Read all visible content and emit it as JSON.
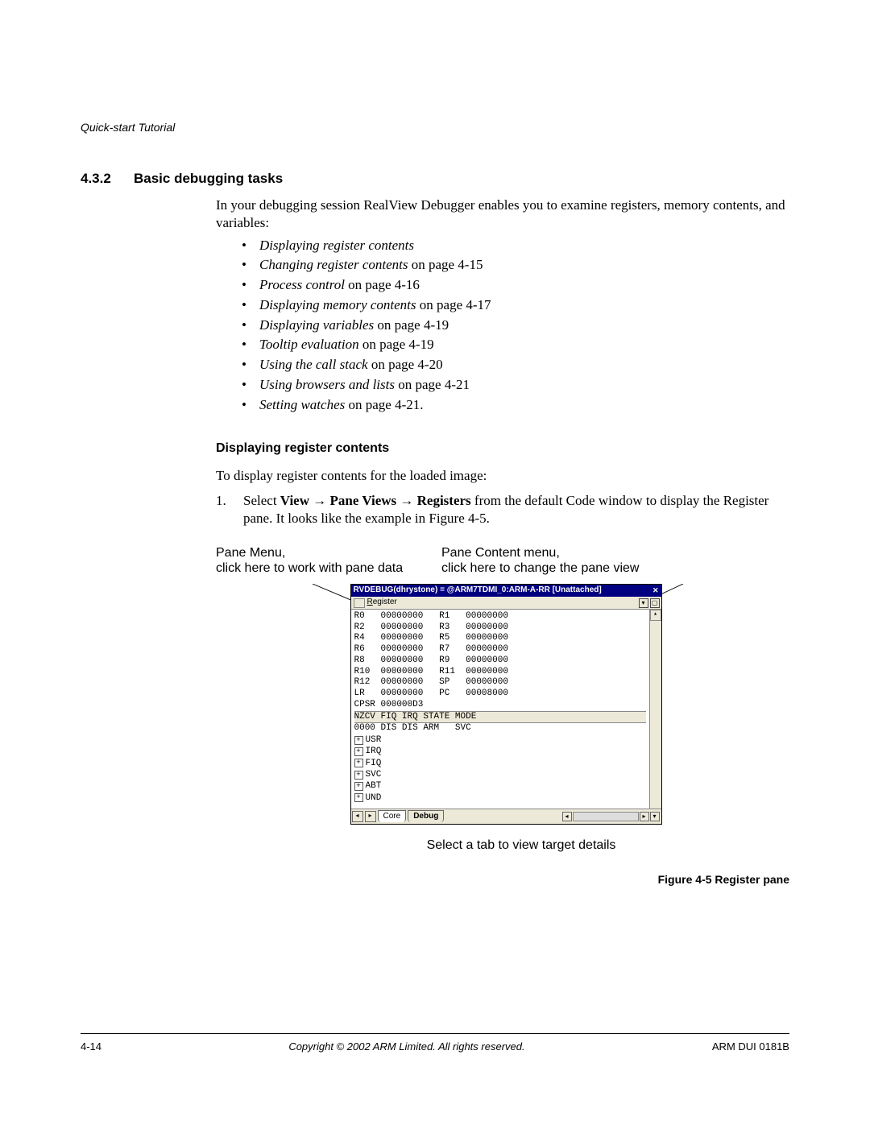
{
  "header": {
    "running_head": "Quick-start Tutorial"
  },
  "section": {
    "number": "4.3.2",
    "title": "Basic debugging tasks"
  },
  "intro": {
    "p1": "In your debugging session RealView Debugger enables you to examine registers, memory contents, and variables:"
  },
  "bullets": [
    {
      "ital": "Displaying register contents",
      "rest": ""
    },
    {
      "ital": "Changing register contents",
      "rest": " on page 4-15"
    },
    {
      "ital": "Process control",
      "rest": " on page 4-16"
    },
    {
      "ital": "Displaying memory contents",
      "rest": " on page 4-17"
    },
    {
      "ital": "Displaying variables",
      "rest": " on page 4-19"
    },
    {
      "ital": "Tooltip evaluation",
      "rest": " on page 4-19"
    },
    {
      "ital": "Using the call stack",
      "rest": " on page 4-20"
    },
    {
      "ital": "Using browsers and lists",
      "rest": " on page 4-21"
    },
    {
      "ital": "Setting watches",
      "rest": " on page 4-21."
    }
  ],
  "sub": {
    "heading": "Displaying register contents",
    "p1": "To display register contents for the loaded image:",
    "step1": {
      "num": "1.",
      "pre": "Select ",
      "m1": "View",
      "arrow1": " → ",
      "m2": "Pane Views",
      "arrow2": " → ",
      "m3": "Registers",
      "post": " from the default Code window to display the Register pane. It looks like the example in Figure 4-5."
    }
  },
  "labels": {
    "left_l1": "Pane Menu,",
    "left_l2": "click here to work with pane data",
    "right_l1": "Pane Content menu,",
    "right_l2": "click here to change the pane view",
    "below": "Select a tab to view target details"
  },
  "figure": {
    "caption": "Figure 4-5 Register pane"
  },
  "window": {
    "title": "RVDEBUG(dhrystone) = @ARM7TDMI_0:ARM-A-RR [Unattached]",
    "menu": {
      "register": "Register"
    },
    "registers": [
      [
        "R0",
        "00000000",
        "R1",
        "00000000"
      ],
      [
        "R2",
        "00000000",
        "R3",
        "00000000"
      ],
      [
        "R4",
        "00000000",
        "R5",
        "00000000"
      ],
      [
        "R6",
        "00000000",
        "R7",
        "00000000"
      ],
      [
        "R8",
        "00000000",
        "R9",
        "00000000"
      ],
      [
        "R10",
        "00000000",
        "R11",
        "00000000"
      ],
      [
        "R12",
        "00000000",
        "SP",
        "00000000"
      ],
      [
        "LR",
        "00000000",
        "PC",
        "00008000"
      ]
    ],
    "cpsr": {
      "label": "CPSR",
      "value": "000000D3"
    },
    "status_header": [
      "NZCV",
      "FIQ",
      "IRQ",
      "STATE",
      "MODE"
    ],
    "status_row": [
      "0000",
      "DIS",
      "DIS",
      "ARM",
      "SVC"
    ],
    "modes": [
      "USR",
      "IRQ",
      "FIQ",
      "SVC",
      "ABT",
      "UND"
    ],
    "tabs": {
      "core": "Core",
      "debug": "Debug"
    }
  },
  "footer": {
    "left": "4-14",
    "center": "Copyright © 2002 ARM Limited. All rights reserved.",
    "right": "ARM DUI 0181B"
  }
}
